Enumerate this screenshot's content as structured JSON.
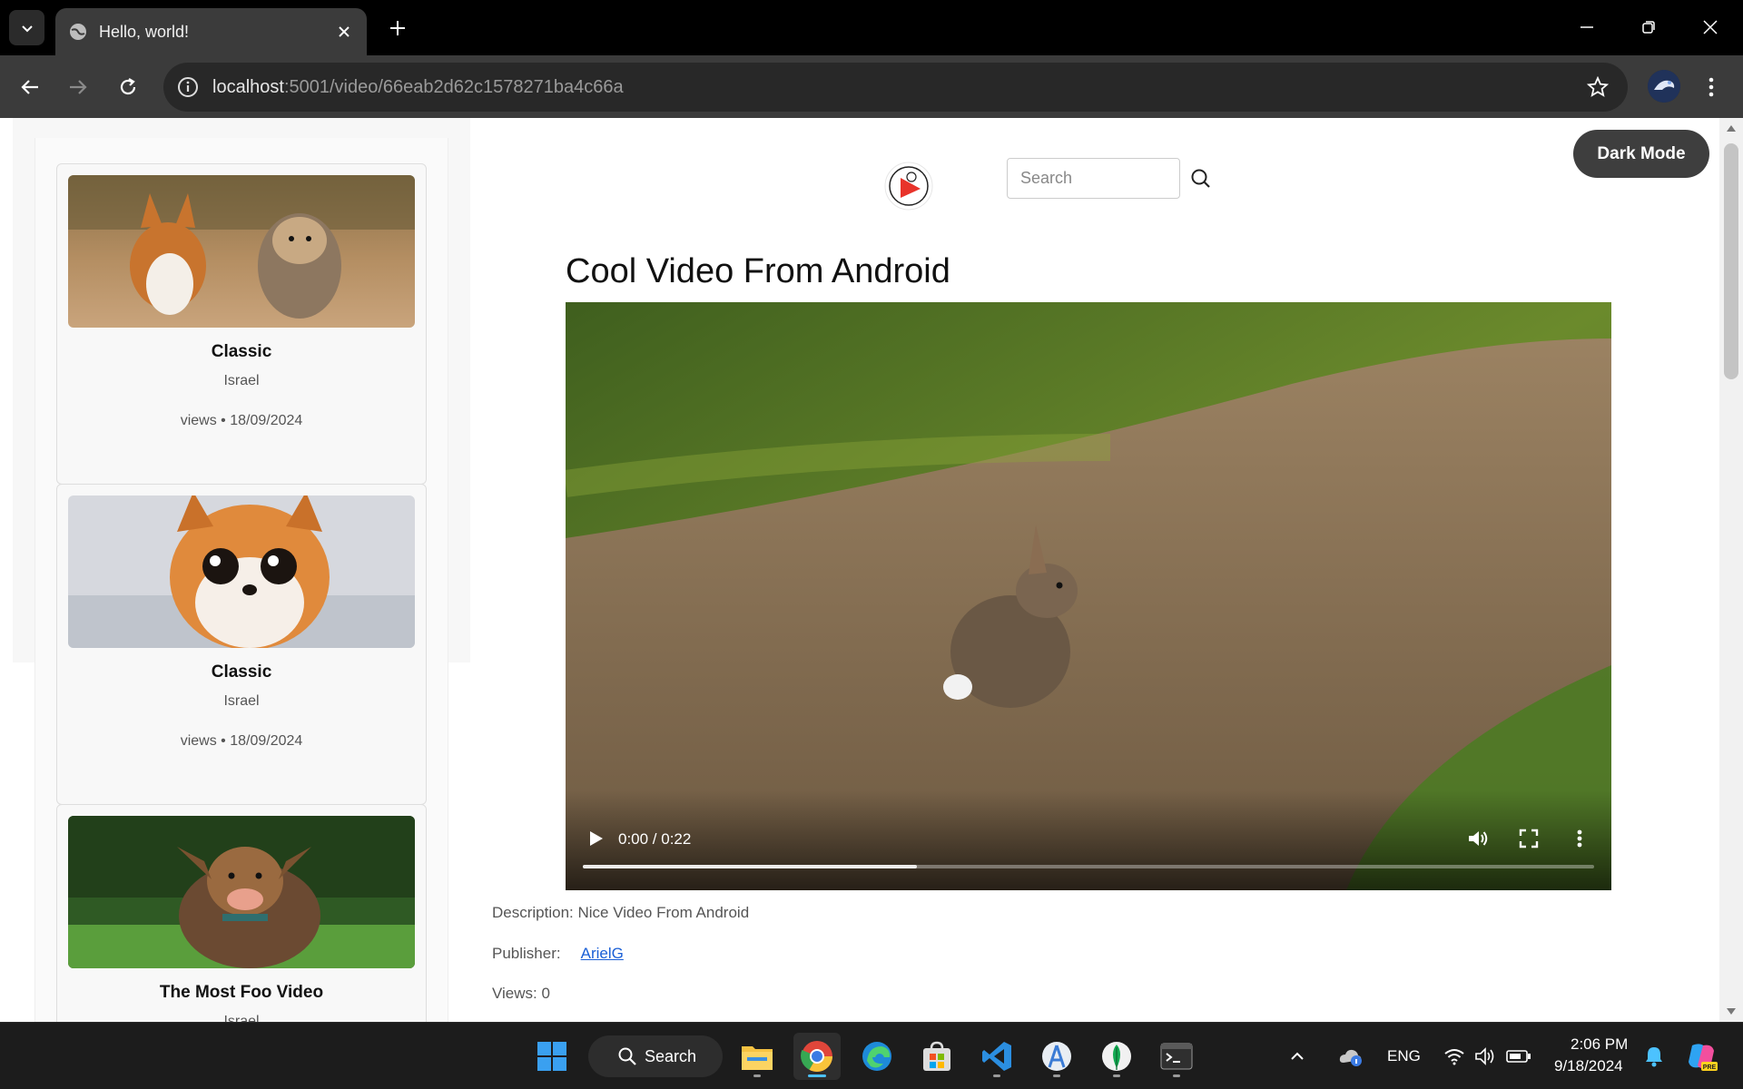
{
  "browser": {
    "tab_title": "Hello, world!",
    "url_host": "localhost",
    "url_rest": ":5001/video/66eab2d62c1578271ba4c66a"
  },
  "header": {
    "search_placeholder": "Search",
    "dark_mode_label": "Dark Mode"
  },
  "sidebar": {
    "cards": [
      {
        "title": "Classic",
        "author": "Israel",
        "meta": "views • 18/09/2024",
        "thumb": "corgi-and-yorkie"
      },
      {
        "title": "Classic",
        "author": "Israel",
        "meta": "views • 18/09/2024",
        "thumb": "fluffy-fox-cub"
      },
      {
        "title": "The Most Foo Video",
        "author": "Israel",
        "meta": "",
        "thumb": "happy-dog"
      }
    ]
  },
  "video": {
    "title": "Cool Video From Android",
    "time": "0:00 / 0:22",
    "buffered_fraction": 0.33
  },
  "details": {
    "description": "Description: Nice Video From Android",
    "publisher_label": "Publisher:",
    "publisher_name": "ArielG",
    "views": "Views: 0"
  },
  "taskbar": {
    "search_label": "Search",
    "language": "ENG",
    "time": "2:06 PM",
    "date": "9/18/2024"
  },
  "colors": {
    "accent_link": "#1a5fd6",
    "dark_button": "#3e3e3e",
    "taskbar_bg": "#1c1c1c"
  }
}
